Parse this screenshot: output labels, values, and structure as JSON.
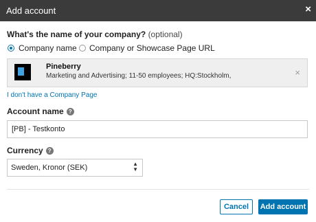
{
  "dialog": {
    "title": "Add account",
    "close_symbol": "×"
  },
  "company": {
    "question": "What's the name of your company?",
    "optional_text": "(optional)",
    "radio_options": [
      {
        "label": "Company name",
        "selected": true
      },
      {
        "label": "Company or Showcase Page URL",
        "selected": false
      }
    ],
    "selected_company": {
      "name": "Pineberry",
      "description": "Marketing and Advertising; 11-50 employees; HQ:Stockholm,",
      "logo_icon": "pineberry-logo",
      "remove_symbol": "×"
    },
    "no_page_link": "I don't have a Company Page"
  },
  "account_name": {
    "label": "Account name",
    "help_symbol": "?",
    "value": "[PB] - Testkonto"
  },
  "currency": {
    "label": "Currency",
    "help_symbol": "?",
    "selected": "Sweden, Kronor (SEK)"
  },
  "buttons": {
    "cancel": "Cancel",
    "submit": "Add account"
  },
  "colors": {
    "titlebar": "#3b3b3b",
    "accent": "#0073b1"
  }
}
